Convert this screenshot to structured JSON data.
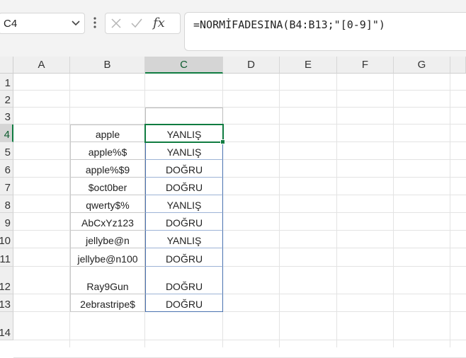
{
  "namebox": {
    "value": "C4"
  },
  "formula_bar": {
    "formula": "=NORMİFADESINA(B4:B13;\"[0-9]\")",
    "fx_label": "fx"
  },
  "columns": [
    "A",
    "B",
    "C",
    "D",
    "E",
    "F",
    "G"
  ],
  "rows": [
    "1",
    "2",
    "3",
    "4",
    "5",
    "6",
    "7",
    "8",
    "9",
    "10",
    "11",
    "12",
    "13",
    "14"
  ],
  "active_cell": "C4",
  "data_rows": [
    {
      "b": "apple",
      "c": "YANLIŞ"
    },
    {
      "b": "apple%$",
      "c": "YANLIŞ"
    },
    {
      "b": "apple%$9",
      "c": "DOĞRU"
    },
    {
      "b": "$oct0ber",
      "c": "DOĞRU"
    },
    {
      "b": "qwerty$%",
      "c": "YANLIŞ"
    },
    {
      "b": "AbCxYz123",
      "c": "DOĞRU"
    },
    {
      "b": "jellybe@n",
      "c": "YANLIŞ"
    },
    {
      "b": "jellybe@n100",
      "c": "DOĞRU"
    },
    {
      "b": "Ray9Gun",
      "c": "DOĞRU"
    },
    {
      "b": "2ebrastripe$",
      "c": "DOĞRU"
    }
  ],
  "colors": {
    "selection": "#107c41",
    "spill_border": "#4a72b0"
  }
}
